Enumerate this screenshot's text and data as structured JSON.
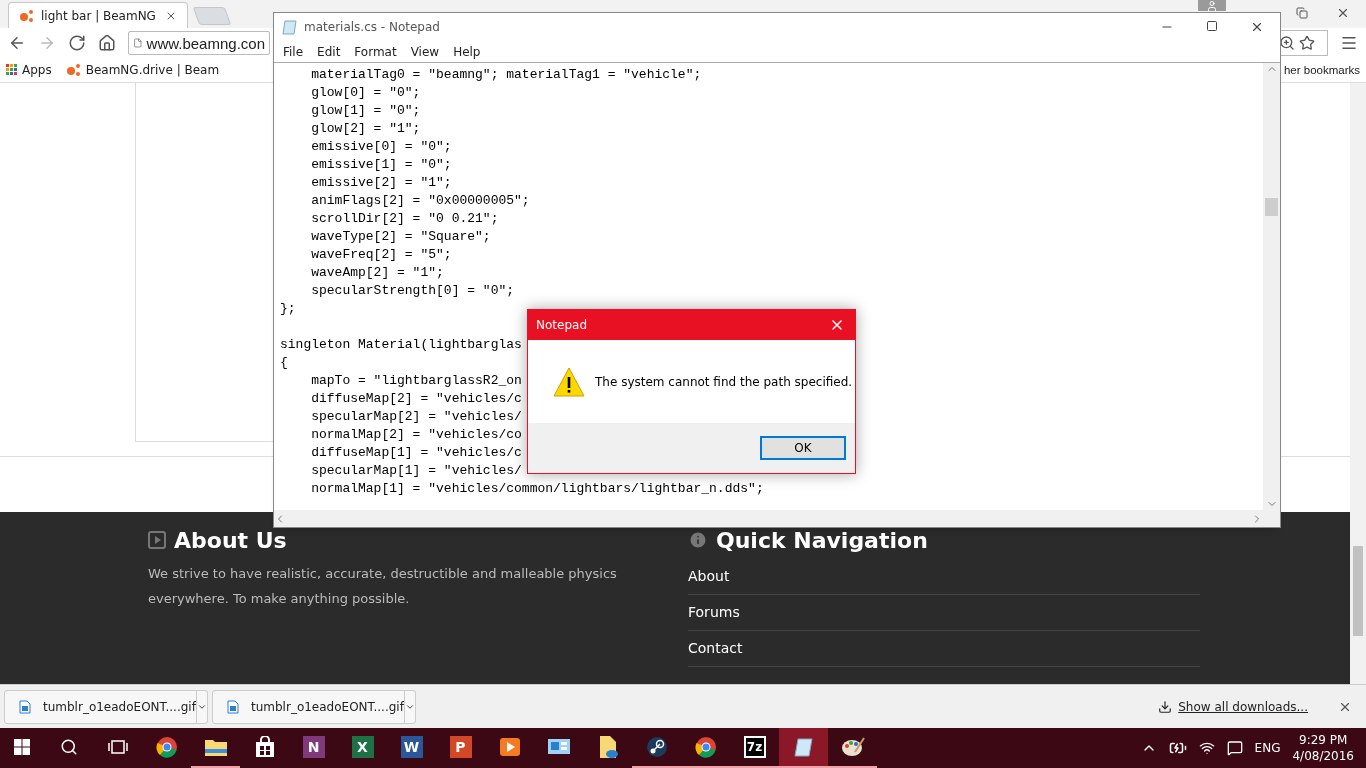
{
  "browser": {
    "tab": {
      "title": "light bar | BeamNG"
    },
    "address": "www.beamng.con",
    "bookmarks": [
      {
        "kind": "apps",
        "label": "Apps"
      },
      {
        "kind": "site",
        "label": "BeamNG.drive | Beam"
      }
    ],
    "other_bookmarks": "her bookmarks"
  },
  "footer": {
    "about": {
      "title": "About Us",
      "text": "We strive to have realistic, accurate, destructible and malleable physics everywhere. To make anything possible."
    },
    "quick_nav": {
      "title": "Quick Navigation",
      "links": [
        "About",
        "Forums",
        "Contact"
      ]
    }
  },
  "downloads": {
    "items": [
      {
        "name": "tumblr_o1eadoEONT....gif"
      },
      {
        "name": "tumblr_o1eadoEONT....gif"
      }
    ],
    "show_all": "Show all downloads..."
  },
  "notepad": {
    "title": "materials.cs - Notepad",
    "menu": [
      "File",
      "Edit",
      "Format",
      "View",
      "Help"
    ],
    "lines": [
      {
        "kind": "code",
        "text": "    materialTag0 = \"beamng\"; materialTag1 = \"vehicle\";"
      },
      {
        "kind": "code",
        "text": "    glow[0] = \"0\";"
      },
      {
        "kind": "code",
        "text": "    glow[1] = \"0\";"
      },
      {
        "kind": "code",
        "text": "    glow[2] = \"1\";"
      },
      {
        "kind": "code",
        "text": "    emissive[0] = \"0\";"
      },
      {
        "kind": "code",
        "text": "    emissive[1] = \"0\";"
      },
      {
        "kind": "code",
        "text": "    emissive[2] = \"1\";"
      },
      {
        "kind": "code",
        "text": "    animFlags[2] = \"0x00000005\";"
      },
      {
        "kind": "code",
        "text": "    scrollDir[2] = \"0 0.21\";"
      },
      {
        "kind": "code",
        "text": "    waveType[2] = \"Square\";"
      },
      {
        "kind": "code",
        "text": "    waveFreq[2] = \"5\";"
      },
      {
        "kind": "code",
        "text": "    waveAmp[2] = \"1\";"
      },
      {
        "kind": "code",
        "text": "    specularStrength[0] = \"0\";"
      },
      {
        "kind": "code",
        "text": "};"
      },
      {
        "kind": "blank"
      },
      {
        "kind": "code",
        "text": "singleton Material(lightbarglas"
      },
      {
        "kind": "code",
        "text": "{"
      },
      {
        "kind": "code",
        "text": "    mapTo = \"lightbarglassR2_on"
      },
      {
        "kind": "code",
        "text": "    diffuseMap[2] = \"vehicles/c"
      },
      {
        "kind": "code",
        "text": "    specularMap[2] = \"vehicles/"
      },
      {
        "kind": "code",
        "text": "    normalMap[2] = \"vehicles/co"
      },
      {
        "kind": "code",
        "text": "    diffuseMap[1] = \"vehicles/c"
      },
      {
        "kind": "code",
        "text": "    specularMap[1] = \"vehicles/"
      },
      {
        "kind": "code",
        "text": "    normalMap[1] = \"vehicles/common/lightbars/lightbar_n.dds\";"
      }
    ]
  },
  "dialog": {
    "title": "Notepad",
    "message": "The system cannot find the path specified.",
    "button": "OK"
  },
  "taskbar": {
    "apps": [
      {
        "kind": "chrome",
        "running": false,
        "active": false
      },
      {
        "kind": "explorer",
        "running": true,
        "active": false
      },
      {
        "kind": "store",
        "running": false,
        "active": false
      },
      {
        "kind": "tile",
        "label": "N",
        "color": "#80397b",
        "running": false,
        "active": false
      },
      {
        "kind": "tile",
        "label": "X",
        "color": "#1e7145",
        "running": false,
        "active": false
      },
      {
        "kind": "tile",
        "label": "W",
        "color": "#2b579a",
        "running": false,
        "active": false
      },
      {
        "kind": "tile",
        "label": "P",
        "color": "#d24726",
        "running": false,
        "active": false
      },
      {
        "kind": "media",
        "running": false,
        "active": false
      },
      {
        "kind": "remote",
        "running": false,
        "active": false
      },
      {
        "kind": "folder",
        "running": false,
        "active": false
      },
      {
        "kind": "steam",
        "running": true,
        "active": false
      },
      {
        "kind": "chrome",
        "running": true,
        "active": false
      },
      {
        "kind": "tile",
        "label": "7z",
        "color": "#000000",
        "running": true,
        "active": false
      },
      {
        "kind": "notepad",
        "running": true,
        "active": true
      },
      {
        "kind": "paint",
        "running": true,
        "active": false
      }
    ],
    "language": "ENG",
    "time": "9:29 PM",
    "date": "4/08/2016"
  }
}
